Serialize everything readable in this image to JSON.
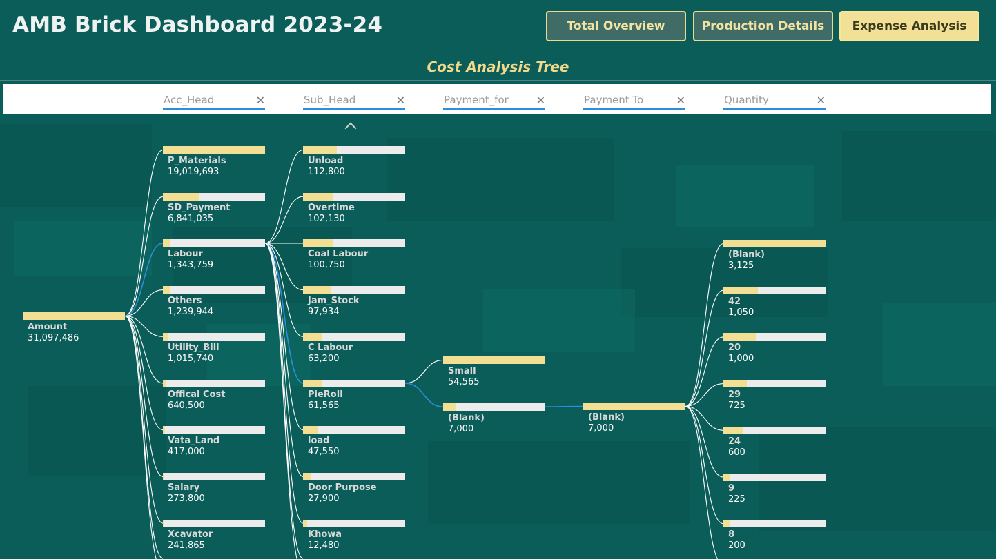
{
  "header": {
    "title": "AMB Brick Dashboard 2023-24",
    "nav": [
      "Total Overview",
      "Production Details",
      "Expense Analysis"
    ],
    "active_nav": "Expense Analysis"
  },
  "subtitle": "Cost Analysis Tree",
  "filters": [
    "Acc_Head",
    "Sub_Head",
    "Payment_for",
    "Payment To",
    "Quantity"
  ],
  "tree": {
    "root": {
      "label": "Amount",
      "value": "31,097,486",
      "fill": 1.0
    },
    "acc_head": [
      {
        "label": "P_Materials",
        "value": "19,019,693",
        "fill": 1.0
      },
      {
        "label": "SD_Payment",
        "value": "6,841,035",
        "fill": 0.36
      },
      {
        "label": "Labour",
        "value": "1,343,759",
        "fill": 0.07
      },
      {
        "label": "Others",
        "value": "1,239,944",
        "fill": 0.065
      },
      {
        "label": "Utility_Bill",
        "value": "1,015,740",
        "fill": 0.053
      },
      {
        "label": "Offical Cost",
        "value": "640,500",
        "fill": 0.034
      },
      {
        "label": "Vata_Land",
        "value": "417,000",
        "fill": 0.022
      },
      {
        "label": "Salary",
        "value": "273,800",
        "fill": 0.014
      },
      {
        "label": "Xcavator",
        "value": "241,865",
        "fill": 0.013
      }
    ],
    "sub_head": [
      {
        "label": "Unload",
        "value": "112,800",
        "fill": 0.33
      },
      {
        "label": "Overtime",
        "value": "102,130",
        "fill": 0.3
      },
      {
        "label": "Coal Labour",
        "value": "100,750",
        "fill": 0.29
      },
      {
        "label": "Jam_Stock",
        "value": "97,934",
        "fill": 0.28
      },
      {
        "label": "C Labour",
        "value": "63,200",
        "fill": 0.19
      },
      {
        "label": "PieRoll",
        "value": "61,565",
        "fill": 0.18
      },
      {
        "label": "load",
        "value": "47,550",
        "fill": 0.14
      },
      {
        "label": "Door Purpose",
        "value": "27,900",
        "fill": 0.08
      },
      {
        "label": "Khowa",
        "value": "12,480",
        "fill": 0.04
      }
    ],
    "payment_for": [
      {
        "label": "Small",
        "value": "54,565",
        "fill": 1.0
      },
      {
        "label": "(Blank)",
        "value": "7,000",
        "fill": 0.13
      }
    ],
    "payment_to": [
      {
        "label": "(Blank)",
        "value": "7,000",
        "fill": 1.0
      }
    ],
    "quantity": [
      {
        "label": "(Blank)",
        "value": "3,125",
        "fill": 1.0
      },
      {
        "label": "42",
        "value": "1,050",
        "fill": 0.34
      },
      {
        "label": "20",
        "value": "1,000",
        "fill": 0.32
      },
      {
        "label": "29",
        "value": "725",
        "fill": 0.23
      },
      {
        "label": "24",
        "value": "600",
        "fill": 0.19
      },
      {
        "label": "9",
        "value": "225",
        "fill": 0.07
      },
      {
        "label": "8",
        "value": "200",
        "fill": 0.064
      }
    ]
  },
  "colors": {
    "background": "#0b5d59",
    "bar_fill": "#f2df93",
    "bar_track": "#ececec",
    "connector": "#ffffff",
    "connector_active": "#2d8fd9"
  }
}
